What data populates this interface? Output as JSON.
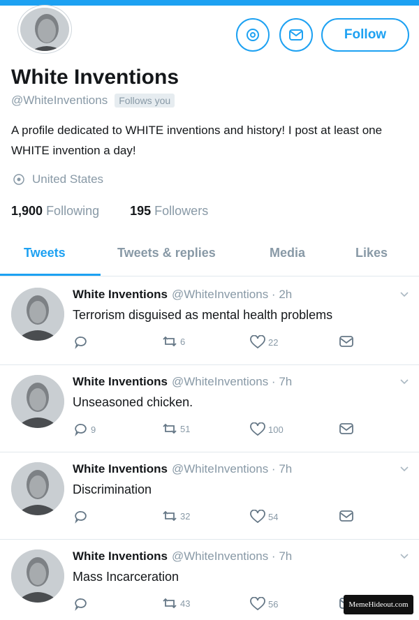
{
  "profile": {
    "name": "White Inventions",
    "handle": "@WhiteInventions",
    "follows_badge": "Follows you",
    "bio": "A profile dedicated to WHITE inventions and history! I post at least one WHITE invention a day!",
    "location": "United States",
    "following_count": "1,900",
    "following_label": "Following",
    "followers_count": "195",
    "followers_label": "Followers",
    "follow_label": "Follow"
  },
  "tabs": [
    {
      "label": "Tweets"
    },
    {
      "label": "Tweets & replies"
    },
    {
      "label": "Media"
    },
    {
      "label": "Likes"
    }
  ],
  "tweets": [
    {
      "name": "White Inventions",
      "meta": "@WhiteInventions · 2h",
      "text": "Terrorism disguised as mental health problems",
      "replies": "",
      "retweets": "6",
      "likes": "22"
    },
    {
      "name": "White Inventions",
      "meta": "@WhiteInventions · 7h",
      "text": "Unseasoned chicken.",
      "replies": "9",
      "retweets": "51",
      "likes": "100"
    },
    {
      "name": "White Inventions",
      "meta": "@WhiteInventions · 7h",
      "text": "Discrimination",
      "replies": "",
      "retweets": "32",
      "likes": "54"
    },
    {
      "name": "White Inventions",
      "meta": "@WhiteInventions · 7h",
      "text": "Mass Incarceration",
      "replies": "",
      "retweets": "43",
      "likes": "56"
    }
  ],
  "icons": {
    "settings": "gear-icon",
    "message": "envelope-icon",
    "location": "location-pin-icon",
    "reply": "reply-icon",
    "retweet": "retweet-icon",
    "like": "heart-icon",
    "dm": "envelope-icon",
    "more": "chevron-down-icon"
  },
  "colors": {
    "accent": "#1da1f2",
    "muted": "#8899a6",
    "text": "#14171a"
  },
  "watermark": "MemeHideout.com"
}
